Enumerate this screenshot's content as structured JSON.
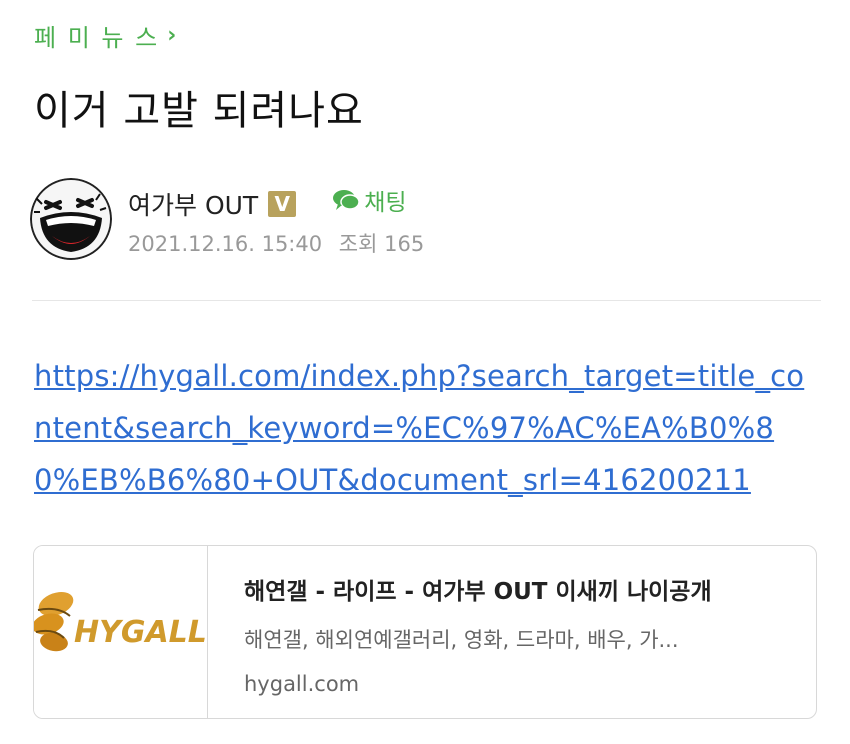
{
  "board": {
    "name": "페 미 뉴 스",
    "chevron": "›"
  },
  "post": {
    "title": "이거 고발 되려나요",
    "author": "여가부 OUT",
    "badge": "V",
    "chat_label": "채팅",
    "date": "2021.12.16. 15:40",
    "views_label": "조회 165",
    "link": "https://hygall.com/index.php?search_target=title_content&search_keyword=%EC%97%AC%EA%B0%80%EB%B6%80+OUT&document_srl=416200211"
  },
  "preview": {
    "title": "해연갤 - 라이프 - 여가부 OUT 이새끼 나이공개",
    "description": "해연갤, 해외연예갤러리, 영화, 드라마, 배우, 가...",
    "domain": "hygall.com",
    "logo_text": "HYGALL.co"
  },
  "colors": {
    "accent_green": "#4caf50",
    "link_blue": "#2f6dd1",
    "badge_gold": "#b8a25d"
  },
  "icons": {
    "avatar": "laughing-face-icon",
    "chat": "chat-bubble-icon",
    "chevron": "chevron-right-icon"
  }
}
